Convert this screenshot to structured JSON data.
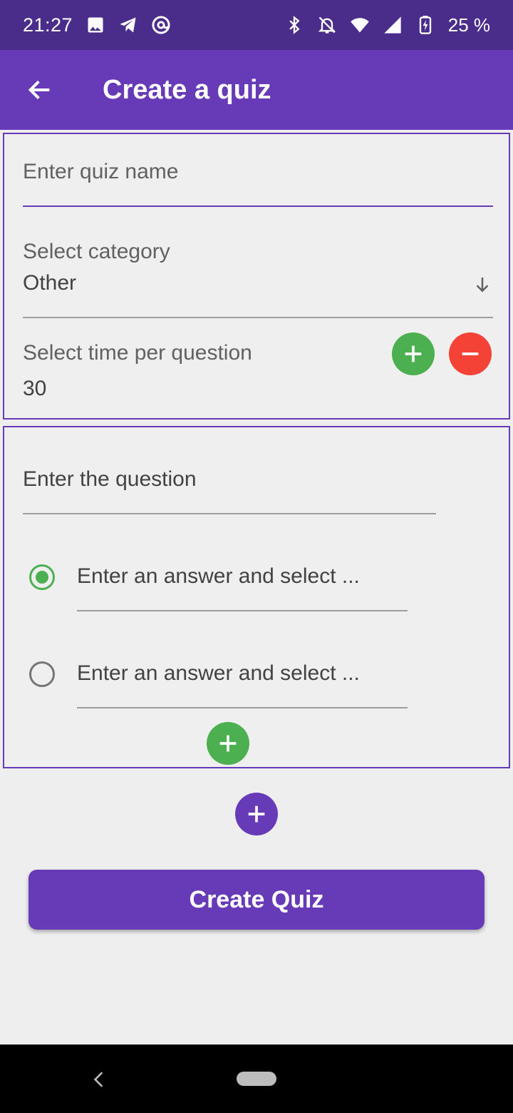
{
  "status_bar": {
    "time": "21:27",
    "battery": "25 %",
    "icons": [
      "image-icon",
      "telegram-icon",
      "at-sign-icon",
      "bluetooth-icon",
      "bell-off-icon",
      "wifi-icon",
      "signal-icon",
      "battery-charging-icon"
    ]
  },
  "app_bar": {
    "title": "Create a quiz",
    "back_icon": "arrow-left-icon"
  },
  "quiz_settings": {
    "name_placeholder": "Enter quiz name",
    "category_label": "Select category",
    "category_value": "Other",
    "time_label": "Select time per question",
    "time_value": "30"
  },
  "question": {
    "question_placeholder": "Enter the question",
    "answers": [
      {
        "placeholder": "Enter an answer and select ...",
        "selected": true
      },
      {
        "placeholder": "Enter an answer and select ...",
        "selected": false
      }
    ]
  },
  "actions": {
    "create_label": "Create Quiz"
  },
  "colors": {
    "primary": "#673ab7",
    "status_bar": "#4a2c8a",
    "add": "#4caf50",
    "remove": "#f44336"
  }
}
